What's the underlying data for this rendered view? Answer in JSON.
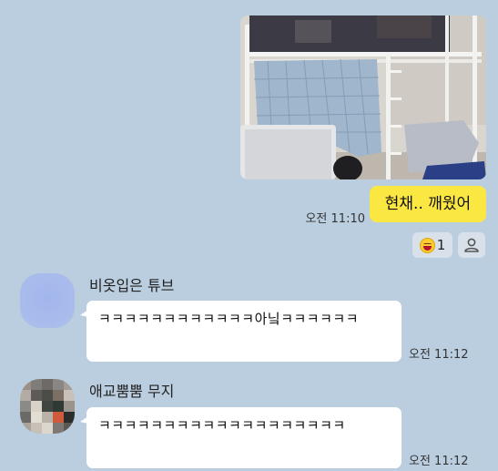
{
  "sent": {
    "photo_icon": "bunk-bed-room-photo",
    "time": "오전 11:10",
    "text": "현채.. 깨웠어",
    "reaction": {
      "emoji": "laughing-face-emoji",
      "count": "1"
    },
    "add_reaction_icon": "person-icon"
  },
  "messages": [
    {
      "sender": "비옷입은 튜브",
      "avatar": "blue-rounded-avatar",
      "text": "ㅋㅋㅋㅋㅋㅋㅋㅋㅋㅋㅋㅋ아닠ㅋㅋㅋㅋㅋㅋ",
      "time": "오전 11:12"
    },
    {
      "sender": "애교뿜뿜 무지",
      "avatar": "pixelated-avatar",
      "text": "ㅋㅋㅋㅋㅋㅋㅋㅋㅋㅋㅋㅋㅋㅋㅋㅋㅋㅋㅋ",
      "time": "오전 11:12"
    }
  ],
  "colors": {
    "background": "#bacee0",
    "sent_bubble": "#fbe742",
    "received_bubble": "#ffffff"
  }
}
